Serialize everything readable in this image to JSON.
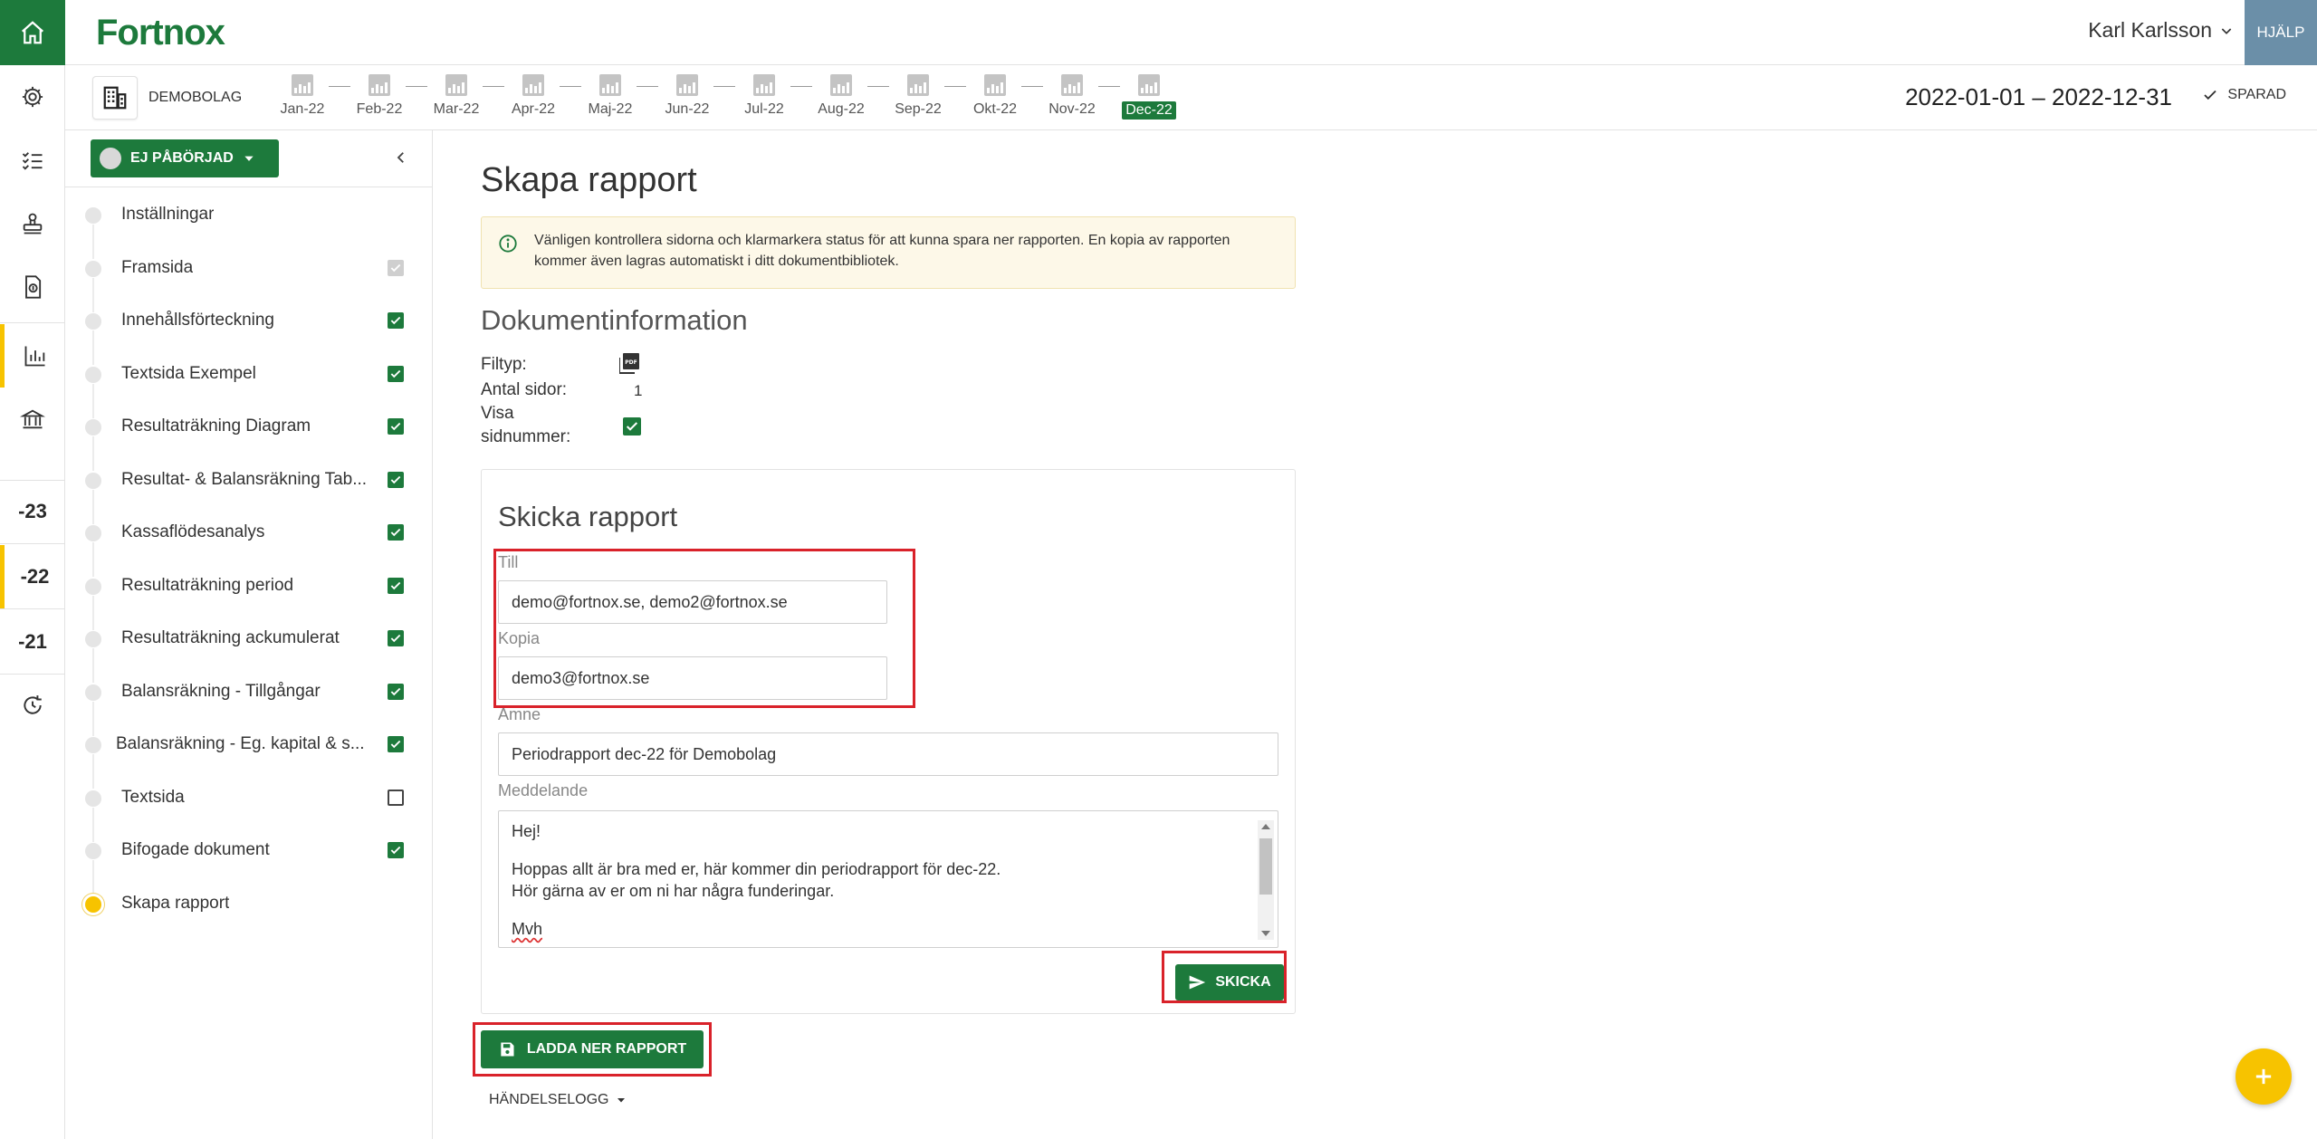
{
  "app": {
    "logo": "Fortnox",
    "user": "Karl Karlsson",
    "help": "HJÄLP",
    "company": "DEMOBOLAG",
    "date_range": "2022-01-01 – 2022-12-31",
    "saved": "SPARAD",
    "accent": "#1d7a3c",
    "highlight": "#f7c300"
  },
  "rail": {
    "years": [
      "-23",
      "-22",
      "-21"
    ]
  },
  "periods": [
    "Jan-22",
    "Feb-22",
    "Mar-22",
    "Apr-22",
    "Maj-22",
    "Jun-22",
    "Jul-22",
    "Aug-22",
    "Sep-22",
    "Okt-22",
    "Nov-22",
    "Dec-22"
  ],
  "sidebar": {
    "status": "EJ PÅBÖRJAD",
    "steps": [
      {
        "label": "Inställningar",
        "check": "none"
      },
      {
        "label": "Framsida",
        "check": "grey"
      },
      {
        "label": "Innehållsförteckning",
        "check": "green"
      },
      {
        "label": "Textsida Exempel",
        "check": "green"
      },
      {
        "label": "Resultaträkning Diagram",
        "check": "green"
      },
      {
        "label": "Resultat- & Balansräkning Tab...",
        "check": "green"
      },
      {
        "label": "Kassaflödesanalys",
        "check": "green"
      },
      {
        "label": "Resultaträkning period",
        "check": "green"
      },
      {
        "label": "Resultaträkning ackumulerat",
        "check": "green"
      },
      {
        "label": "Balansräkning - Tillgångar",
        "check": "green"
      },
      {
        "label": "Balansräkning - Eg. kapital & s...",
        "check": "green"
      },
      {
        "label": "Textsida",
        "check": "empty"
      },
      {
        "label": "Bifogade dokument",
        "check": "green"
      },
      {
        "label": "Skapa rapport",
        "check": "none"
      }
    ]
  },
  "main": {
    "title": "Skapa rapport",
    "info": "Vänligen kontrollera sidorna och klarmarkera status för att kunna spara ner rapporten. En kopia av rapporten kommer även lagras automatiskt i ditt dokumentbibliotek.",
    "doc_section": "Dokumentinformation",
    "filetype_label": "Filtyp:",
    "pages_label": "Antal sidor:",
    "pages_value": "1",
    "show_pagenum_label_1": "Visa",
    "show_pagenum_label_2": "sidnummer:",
    "send": {
      "title": "Skicka rapport",
      "to_label": "Till",
      "to_value": "demo@fortnox.se, demo2@fortnox.se",
      "cc_label": "Kopia",
      "cc_value": "demo3@fortnox.se",
      "subject_label": "Ämne",
      "subject_value": "Periodrapport dec-22 för Demobolag",
      "message_label": "Meddelande",
      "message_l1": "Hej!",
      "message_l2": "Hoppas allt är bra med er, här kommer din periodrapport för dec-22.",
      "message_l3": "Hör gärna av er om ni har några funderingar.",
      "message_l4": "Mvh",
      "send_button": "SKICKA"
    },
    "download_button": "LADDA NER RAPPORT",
    "log": "HÄNDELSELOGG"
  }
}
